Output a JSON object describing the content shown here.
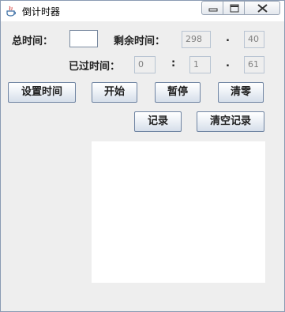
{
  "window": {
    "title": "倒计时器",
    "controls": {
      "minimize_icon": "minimize-icon",
      "maximize_icon": "maximize-icon",
      "close_icon": "close-icon"
    }
  },
  "total_time": {
    "label": "总时间：",
    "value": ""
  },
  "remaining_time": {
    "label": "剩余时间：",
    "minutes": "298",
    "separator": ".",
    "seconds": "40"
  },
  "elapsed_time": {
    "label": "已过时间：",
    "hours": "0",
    "separator1": ":",
    "minutes": "1",
    "separator2": ".",
    "seconds": "61"
  },
  "buttons": {
    "set_time": "设置时间",
    "start": "开始",
    "pause": "暂停",
    "reset": "清零",
    "record": "记录",
    "clear_records": "清空记录"
  },
  "records": []
}
